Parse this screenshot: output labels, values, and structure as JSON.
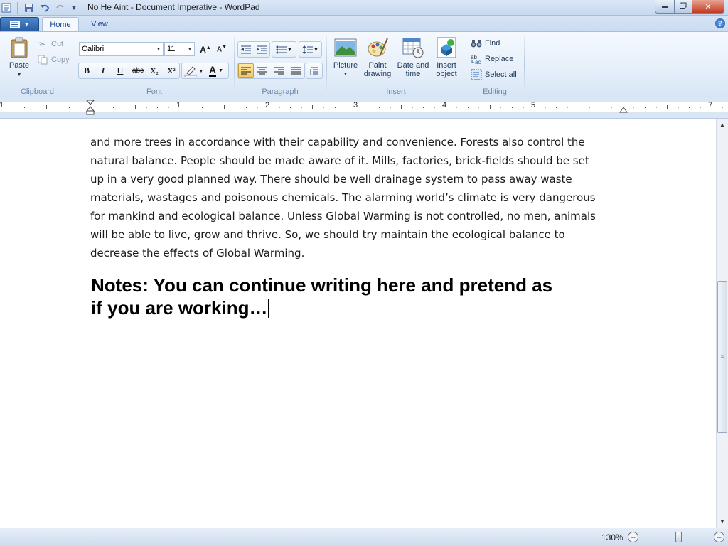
{
  "window": {
    "title": "No He Aint - Document Imperative - WordPad",
    "minimize_icon": "minimize-icon",
    "maximize_icon": "maximize-icon",
    "close_icon": "close-icon"
  },
  "tabs": [
    {
      "label": "Home",
      "active": true
    },
    {
      "label": "View",
      "active": false
    }
  ],
  "ribbon": {
    "clipboard": {
      "label": "Clipboard",
      "paste": "Paste",
      "cut": "Cut",
      "copy": "Copy"
    },
    "font": {
      "label": "Font",
      "family": "Calibri",
      "size": "11",
      "bold": "B",
      "italic": "I",
      "underline": "U",
      "strikethrough": "abc",
      "subscript": "X₂",
      "superscript": "X²",
      "font_color": "A"
    },
    "paragraph": {
      "label": "Paragraph"
    },
    "insert": {
      "label": "Insert",
      "picture": "Picture",
      "paint_drawing_line1": "Paint",
      "paint_drawing_line2": "drawing",
      "date_time_line1": "Date and",
      "date_time_line2": "time",
      "insert_object_line1": "Insert",
      "insert_object_line2": "object"
    },
    "editing": {
      "label": "Editing",
      "find": "Find",
      "replace": "Replace",
      "select_all": "Select all"
    }
  },
  "ruler": {
    "numbers": [
      "1",
      "1",
      "2",
      "3",
      "4",
      "5",
      "7"
    ]
  },
  "document": {
    "body_lines": [
      "and more trees in accordance with their capability and convenience. Forests also control the",
      "natural balance. People should be made aware of it. Mills, factories, brick-fields should be set",
      "up in a very good planned way. There should be well drainage system to pass away waste",
      "materials, wastages and poisonous chemicals. The alarming world’s climate is very dangerous",
      "for mankind and ecological balance. Unless Global Warming is not controlled, no men, animals",
      "will be able to live, grow and thrive. So, we should try maintain the ecological balance to",
      "decrease the effects of Global Warming."
    ],
    "notes_line1": "Notes: You can continue writing here and pretend as",
    "notes_line2": "if you are working…"
  },
  "status": {
    "zoom": "130%",
    "zoom_out": "−",
    "zoom_in": "+"
  },
  "colors": {
    "accent": "#2a5fa6",
    "close_red": "#c23a20",
    "highlight_active": "#f6c45a"
  }
}
